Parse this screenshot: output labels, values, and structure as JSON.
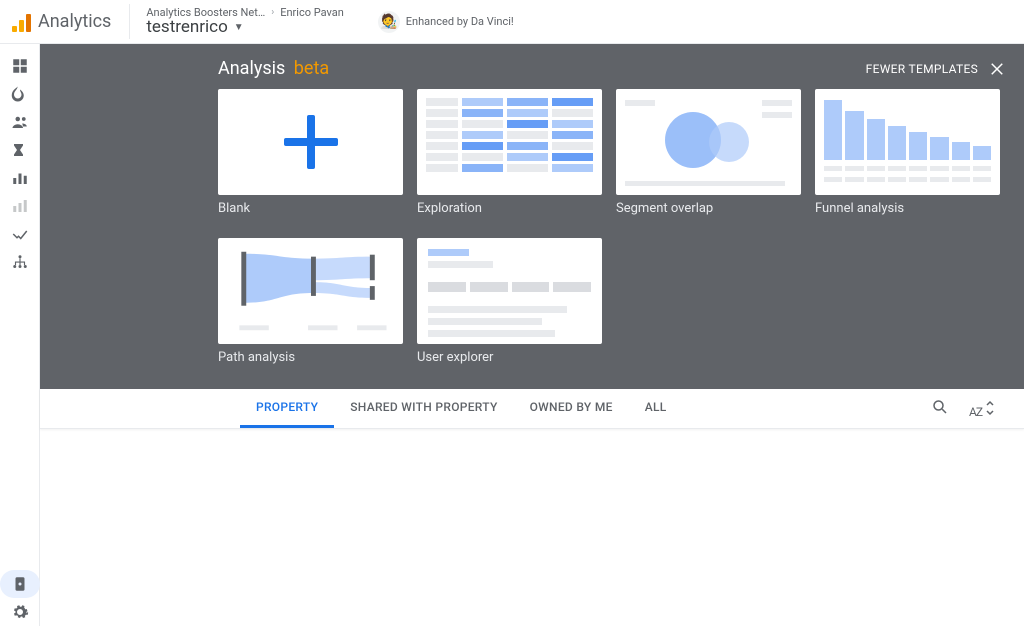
{
  "app": {
    "name": "Analytics"
  },
  "header": {
    "account": "Analytics Boosters Net…",
    "user": "Enrico Pavan",
    "property": "testrenrico",
    "enhanced_label": "Enhanced by Da Vinci!"
  },
  "leftnav": [
    {
      "name": "dashboard-icon"
    },
    {
      "name": "touch-realtime-icon"
    },
    {
      "name": "audience-icon"
    },
    {
      "name": "events-icon"
    },
    {
      "name": "bar-chart-icon"
    },
    {
      "name": "dim-icon"
    },
    {
      "name": "analysis-icon"
    },
    {
      "name": "tree-icon"
    }
  ],
  "leftnav_bottom": [
    {
      "name": "admin-icon",
      "active": true
    },
    {
      "name": "settings-gear-icon"
    }
  ],
  "templates": {
    "title": "Analysis",
    "beta_label": "beta",
    "fewer_label": "FEWER TEMPLATES",
    "cards": [
      {
        "label": "Blank"
      },
      {
        "label": "Exploration"
      },
      {
        "label": "Segment overlap"
      },
      {
        "label": "Funnel analysis"
      },
      {
        "label": "Path analysis"
      },
      {
        "label": "User explorer"
      }
    ]
  },
  "tabs": {
    "items": [
      {
        "label": "PROPERTY",
        "active": true
      },
      {
        "label": "SHARED WITH PROPERTY"
      },
      {
        "label": "OWNED BY ME"
      },
      {
        "label": "ALL"
      }
    ],
    "sort_label": "AZ"
  }
}
